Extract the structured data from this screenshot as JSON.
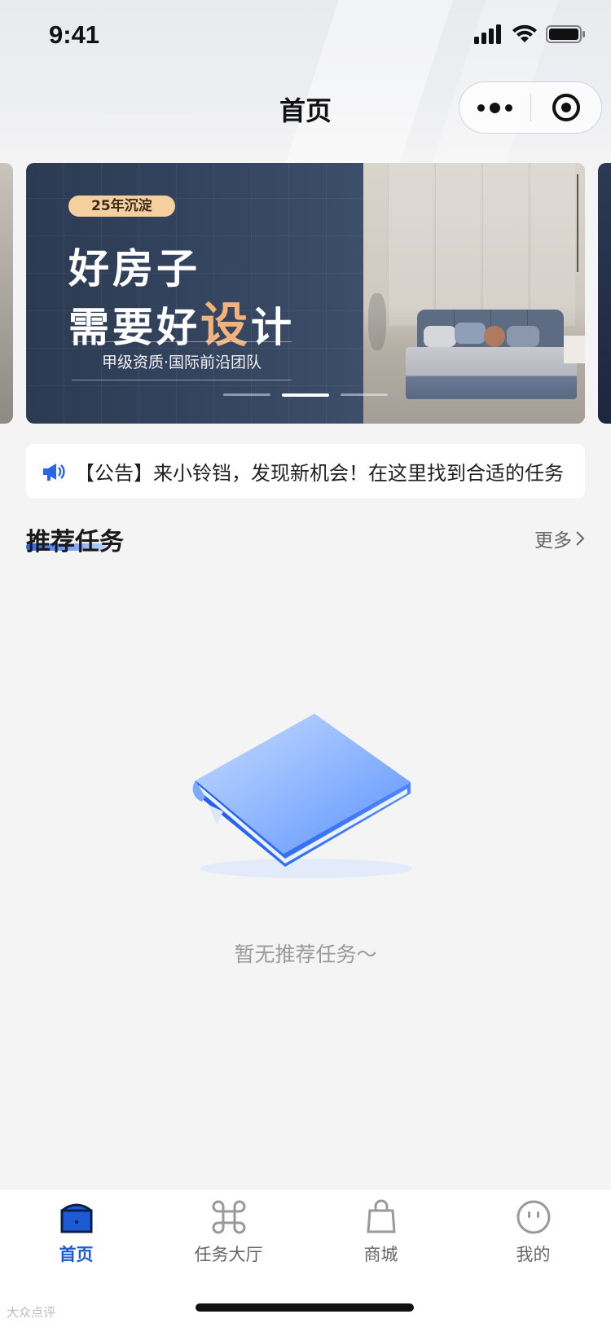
{
  "status_bar": {
    "time": "9:41"
  },
  "nav": {
    "title": "首页"
  },
  "banner": {
    "tag": "25年沉淀",
    "headline_line1": "好房子",
    "headline_line2_pre": "需要好",
    "headline_line2_accent": "设",
    "headline_line2_post": "计",
    "subtitle": "甲级资质·国际前沿团队",
    "active_slide": 2,
    "slide_count": 3
  },
  "notice": {
    "text": "【公告】来小铃铛，发现新机会！在这里找到合适的任务"
  },
  "recommend": {
    "title": "推荐任务",
    "more_label": "更多",
    "empty_text": "暂无推荐任务～"
  },
  "tabbar": {
    "items": [
      {
        "label": "首页",
        "icon": "home-icon",
        "active": true
      },
      {
        "label": "任务大厅",
        "icon": "command-icon",
        "active": false
      },
      {
        "label": "商城",
        "icon": "shopping-bag-icon",
        "active": false
      },
      {
        "label": "我的",
        "icon": "profile-face-icon",
        "active": false
      }
    ]
  },
  "colors": {
    "accent": "#1d5bd6",
    "notice_icon": "#2a66e8",
    "banner_accent": "#f3b27a",
    "tag_bg": "#f6cf9f"
  },
  "watermark": "大众点评"
}
